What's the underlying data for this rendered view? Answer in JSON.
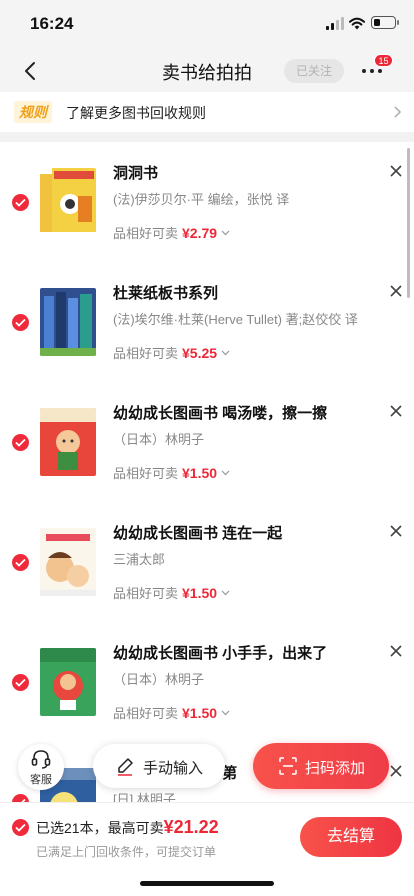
{
  "status_bar": {
    "time": "16:24",
    "battery_level": 0.3
  },
  "nav": {
    "title": "卖书给拍拍",
    "follow_label": "已关注",
    "more_badge": "15"
  },
  "rules": {
    "tag": "规则",
    "text": "了解更多图书回收规则"
  },
  "books": [
    {
      "title": "洞洞书",
      "author": "(法)伊莎贝尔·平 编绘，张悦 译",
      "condition": "品相好可卖",
      "price": "¥2.79",
      "selected": true
    },
    {
      "title": "杜莱纸板书系列",
      "author": "(法)埃尔维·杜莱(Herve Tullet) 著;赵佼佼 译",
      "condition": "品相好可卖",
      "price": "¥5.25",
      "selected": true
    },
    {
      "title": "幼幼成长图画书 喝汤喽，擦一擦",
      "author": "（日本）林明子",
      "condition": "品相好可卖",
      "price": "¥1.50",
      "selected": true
    },
    {
      "title": "幼幼成长图画书 连在一起",
      "author": "三浦太郎",
      "condition": "品相好可卖",
      "price": "¥1.50",
      "selected": true
    },
    {
      "title": "幼幼成长图画书 小手手，出来了",
      "author": "（日本）林明子",
      "condition": "品相好可卖",
      "price": "¥1.50",
      "selected": true
    },
    {
      "title": "幼幼成长图画书 第",
      "author": "[日] 林明子",
      "condition": "",
      "price": "",
      "selected": true
    }
  ],
  "floating": {
    "service_label": "客服",
    "manual_label": "手动输入",
    "scan_label": "扫码添加"
  },
  "bottom": {
    "selected_text": "已选21本，最高可卖",
    "total": "¥21.22",
    "hint": "已满足上门回收条件，可提交订单",
    "checkout_label": "去结算"
  },
  "colors": {
    "accent": "#ee2737",
    "rules_tag": "#f0a11c"
  }
}
